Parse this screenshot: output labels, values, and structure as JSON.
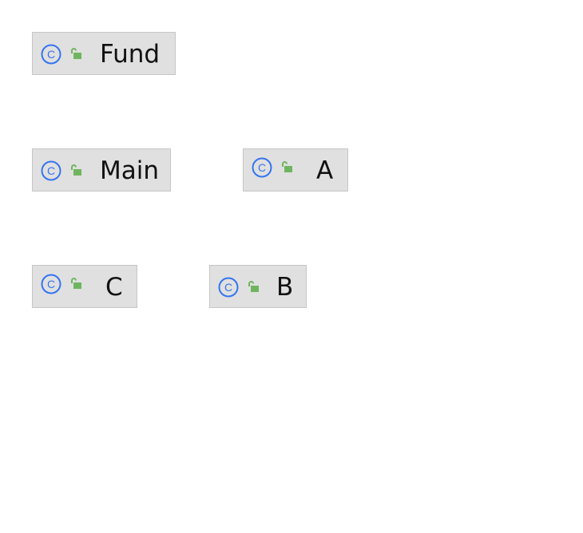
{
  "diagram": {
    "colors": {
      "node_fill": "#e0e0e0",
      "node_border": "#c6c6c6",
      "class_icon": "#3574f0",
      "lock_icon": "#6fb55f",
      "text": "#111111",
      "background": "#ffffff"
    },
    "nodes": [
      {
        "id": "fund",
        "label": "Fund",
        "kind_icon": "class-icon",
        "visibility_icon": "unlocked-lock-icon"
      },
      {
        "id": "main",
        "label": "Main",
        "kind_icon": "class-icon",
        "visibility_icon": "unlocked-lock-icon"
      },
      {
        "id": "a",
        "label": "A",
        "kind_icon": "class-icon",
        "visibility_icon": "unlocked-lock-icon"
      },
      {
        "id": "c",
        "label": "C",
        "kind_icon": "class-icon",
        "visibility_icon": "unlocked-lock-icon"
      },
      {
        "id": "b",
        "label": "B",
        "kind_icon": "class-icon",
        "visibility_icon": "unlocked-lock-icon"
      }
    ]
  }
}
